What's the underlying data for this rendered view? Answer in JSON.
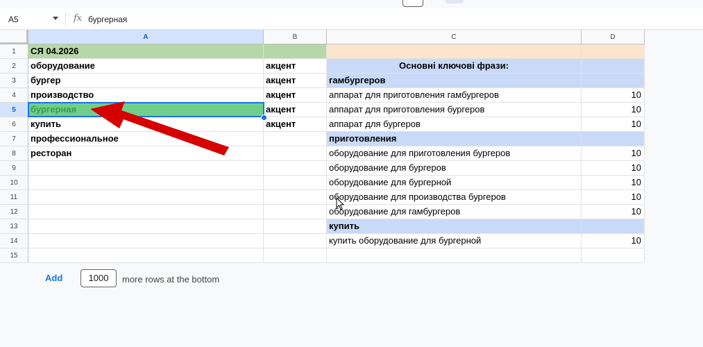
{
  "formula_bar": {
    "name_box": "A5",
    "fx_icon": "function-icon",
    "formula_value": "бургерная"
  },
  "columns": [
    "A",
    "B",
    "C",
    "D"
  ],
  "selected_column": "A",
  "selected_row": "5",
  "rows": [
    {
      "num": "1",
      "a": "СЯ 04.2026",
      "b": "",
      "c": "",
      "d": ""
    },
    {
      "num": "2",
      "a": "оборудование",
      "b": "акцент",
      "c": "Основні ключові фрази:",
      "d": ""
    },
    {
      "num": "3",
      "a": "бургер",
      "b": "акцент",
      "c": "гамбургеров",
      "d": ""
    },
    {
      "num": "4",
      "a": "производство",
      "b": "акцент",
      "c": "аппарат для приготовления гамбургеров",
      "d": "10"
    },
    {
      "num": "5",
      "a": "бургерная",
      "b": "акцент",
      "c": "аппарат для приготовления бургеров",
      "d": "10"
    },
    {
      "num": "6",
      "a": "купить",
      "b": "акцент",
      "c": "аппарат для бургеров",
      "d": "10"
    },
    {
      "num": "7",
      "a": "профессиональное",
      "b": "",
      "c": "приготовления",
      "d": ""
    },
    {
      "num": "8",
      "a": "ресторан",
      "b": "",
      "c": "оборудование для приготовления бургеров",
      "d": "10"
    },
    {
      "num": "9",
      "a": "",
      "b": "",
      "c": "оборудование для бургеров",
      "d": "10"
    },
    {
      "num": "10",
      "a": "",
      "b": "",
      "c": "оборудование для бургерной",
      "d": "10"
    },
    {
      "num": "11",
      "a": "",
      "b": "",
      "c": "оборудование для производства бургеров",
      "d": "10"
    },
    {
      "num": "12",
      "a": "",
      "b": "",
      "c": "оборудование для гамбургеров",
      "d": "10"
    },
    {
      "num": "13",
      "a": "",
      "b": "",
      "c": "купить",
      "d": ""
    },
    {
      "num": "14",
      "a": "",
      "b": "",
      "c": "купить оборудование для бургерной",
      "d": "10"
    },
    {
      "num": "15",
      "a": "",
      "b": "",
      "c": "",
      "d": ""
    }
  ],
  "footer": {
    "add_label": "Add",
    "rows_value": "1000",
    "more_rows_text": "more rows at the bottom"
  },
  "colors": {
    "header_green": "#b6d7a8",
    "header_peach": "#fce5cd",
    "section_blue": "#c9daf8",
    "selected_cell_green": "#6fcf8a",
    "arrow_red": "#d50000",
    "selection_blue": "#1a73e8"
  },
  "annotation": {
    "arrow_icon": "red-arrow-icon",
    "cursor_icon": "mouse-cursor-icon"
  }
}
